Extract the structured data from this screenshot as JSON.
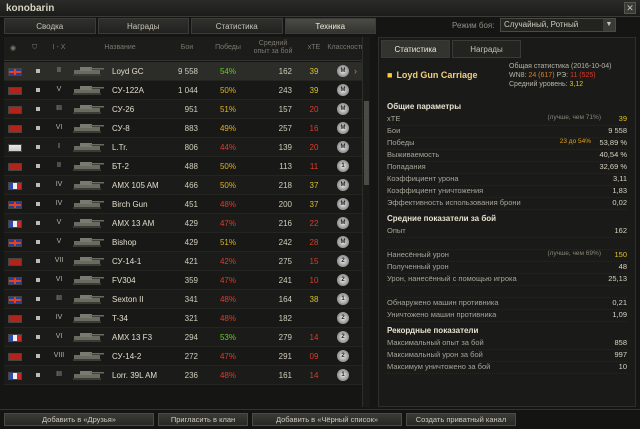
{
  "window": {
    "title": "konobarin"
  },
  "tabs": [
    "Сводка",
    "Награды",
    "Статистика",
    "Техника"
  ],
  "active_tab": 3,
  "battle_mode": {
    "label": "Режим боя:",
    "value": "Случайный, Ротный"
  },
  "table": {
    "headers": {
      "tier": "I - X",
      "name": "Название",
      "battles": "Бои",
      "wins": "Победы",
      "avg_xp_1": "Средний",
      "avg_xp_2": "опыт за бой",
      "xte": "xTE",
      "class": "Классность"
    },
    "rows": [
      {
        "flag": "uk",
        "tier": "II",
        "name": "Loyd GC",
        "battles": "9 558",
        "wins": "54%",
        "wins_color": "green",
        "avg": "162",
        "xte": "39",
        "xte_color": "yellow",
        "cls": "M",
        "selected": true
      },
      {
        "flag": "su",
        "tier": "V",
        "name": "СУ-122А",
        "battles": "1 044",
        "wins": "50%",
        "wins_color": "orange",
        "avg": "243",
        "xte": "39",
        "xte_color": "yellow",
        "cls": "M"
      },
      {
        "flag": "su",
        "tier": "III",
        "name": "СУ-26",
        "battles": "951",
        "wins": "51%",
        "wins_color": "orange",
        "avg": "157",
        "xte": "20",
        "xte_color": "red",
        "cls": "M"
      },
      {
        "flag": "su",
        "tier": "VI",
        "name": "СУ-8",
        "battles": "883",
        "wins": "49%",
        "wins_color": "orange",
        "avg": "257",
        "xte": "16",
        "xte_color": "red",
        "cls": "M"
      },
      {
        "flag": "de",
        "tier": "I",
        "name": "L.Tr.",
        "battles": "806",
        "wins": "44%",
        "wins_color": "red",
        "avg": "139",
        "xte": "20",
        "xte_color": "red",
        "cls": "M"
      },
      {
        "flag": "su",
        "tier": "II",
        "name": "БТ-2",
        "battles": "488",
        "wins": "50%",
        "wins_color": "orange",
        "avg": "113",
        "xte": "11",
        "xte_color": "red",
        "cls": "1"
      },
      {
        "flag": "fr",
        "tier": "IV",
        "name": "AMX 105 AM",
        "battles": "466",
        "wins": "50%",
        "wins_color": "orange",
        "avg": "218",
        "xte": "37",
        "xte_color": "yellow",
        "cls": "M"
      },
      {
        "flag": "uk",
        "tier": "IV",
        "name": "Birch Gun",
        "battles": "451",
        "wins": "48%",
        "wins_color": "red",
        "avg": "200",
        "xte": "37",
        "xte_color": "yellow",
        "cls": "M"
      },
      {
        "flag": "fr",
        "tier": "V",
        "name": "AMX 13 AM",
        "battles": "429",
        "wins": "47%",
        "wins_color": "red",
        "avg": "216",
        "xte": "22",
        "xte_color": "red",
        "cls": "M"
      },
      {
        "flag": "uk",
        "tier": "V",
        "name": "Bishop",
        "battles": "429",
        "wins": "51%",
        "wins_color": "orange",
        "avg": "242",
        "xte": "28",
        "xte_color": "red",
        "cls": "M"
      },
      {
        "flag": "su",
        "tier": "VII",
        "name": "СУ-14-1",
        "battles": "421",
        "wins": "42%",
        "wins_color": "red",
        "avg": "275",
        "xte": "15",
        "xte_color": "red",
        "cls": "2"
      },
      {
        "flag": "uk",
        "tier": "VI",
        "name": "FV304",
        "battles": "359",
        "wins": "47%",
        "wins_color": "red",
        "avg": "241",
        "xte": "10",
        "xte_color": "red",
        "cls": "2"
      },
      {
        "flag": "uk",
        "tier": "III",
        "name": "Sexton II",
        "battles": "341",
        "wins": "48%",
        "wins_color": "red",
        "avg": "164",
        "xte": "38",
        "xte_color": "yellow",
        "cls": "1"
      },
      {
        "flag": "su",
        "tier": "IV",
        "name": "T-34",
        "battles": "321",
        "wins": "48%",
        "wins_color": "red",
        "avg": "182",
        "xte": "",
        "xte_color": "red",
        "cls": "2"
      },
      {
        "flag": "fr",
        "tier": "VI",
        "name": "AMX 13 F3",
        "battles": "294",
        "wins": "53%",
        "wins_color": "green",
        "avg": "279",
        "xte": "14",
        "xte_color": "red",
        "cls": "2"
      },
      {
        "flag": "su",
        "tier": "VIII",
        "name": "СУ-14-2",
        "battles": "272",
        "wins": "47%",
        "wins_color": "red",
        "avg": "291",
        "xte": "09",
        "xte_color": "red",
        "cls": "2"
      },
      {
        "flag": "fr",
        "tier": "III",
        "name": "Lorr. 39L AM",
        "battles": "236",
        "wins": "48%",
        "wins_color": "red",
        "avg": "161",
        "xte": "14",
        "xte_color": "red",
        "cls": "1"
      }
    ]
  },
  "right_panel": {
    "tabs": [
      "Статистика",
      "Награды"
    ],
    "vehicle": "Loyd Gun Carriage",
    "overall_line1": "Общая статистика (2016-10-04)",
    "overall_wn8_label": "WN8: ",
    "overall_wn8": "24 (617)",
    "overall_re_label": " РЭ: ",
    "overall_re": "11 (525)",
    "overall_level_label": "Средний уровень: ",
    "overall_level": "3,12",
    "sections": [
      {
        "title": "Общие параметры",
        "rows": [
          {
            "label": "xTE",
            "note": "(лучше, чем 71%)",
            "value": "39",
            "value_color": "#e0c020"
          },
          {
            "label": "Бои",
            "value": "9 558"
          },
          {
            "label": "Победы",
            "note2": "23 до 54%",
            "value": "53,89 %"
          },
          {
            "label": "Выживаемость",
            "value": "40,54 %"
          },
          {
            "label": "Попадания",
            "value": "32,69 %"
          },
          {
            "label": "Коэффициент урона",
            "value": "3,11"
          },
          {
            "label": "Коэффициент уничтожения",
            "value": "1,83"
          },
          {
            "label": "Эффективность использования брони",
            "value": "0,02"
          }
        ]
      },
      {
        "title": "Средние показатели за бой",
        "rows": [
          {
            "label": "Опыт",
            "value": "162"
          },
          {
            "label": "",
            "value": ""
          },
          {
            "label": "Нанесённый урон",
            "note": "(лучше, чем 69%)",
            "value": "150",
            "value_color": "#e0c020"
          },
          {
            "label": "Полученный урон",
            "value": "48"
          },
          {
            "label": "Урон, нанесённый с помощью игрока",
            "value": "25,13"
          },
          {
            "label": "",
            "value": ""
          },
          {
            "label": "Обнаружено машин противника",
            "value": "0,21"
          },
          {
            "label": "Уничтожено машин противника",
            "value": "1,09"
          }
        ]
      },
      {
        "title": "Рекордные показатели",
        "rows": [
          {
            "label": "Максимальный опыт за бой",
            "value": "858"
          },
          {
            "label": "Максимальный урон за бой",
            "value": "997"
          },
          {
            "label": "Максимум уничтожено за бой",
            "value": "10"
          }
        ]
      }
    ]
  },
  "bottom_buttons": [
    "Добавить в «Друзья»",
    "Пригласить в клан",
    "Добавить в «Чёрный список»",
    "Создать приватный канал"
  ]
}
